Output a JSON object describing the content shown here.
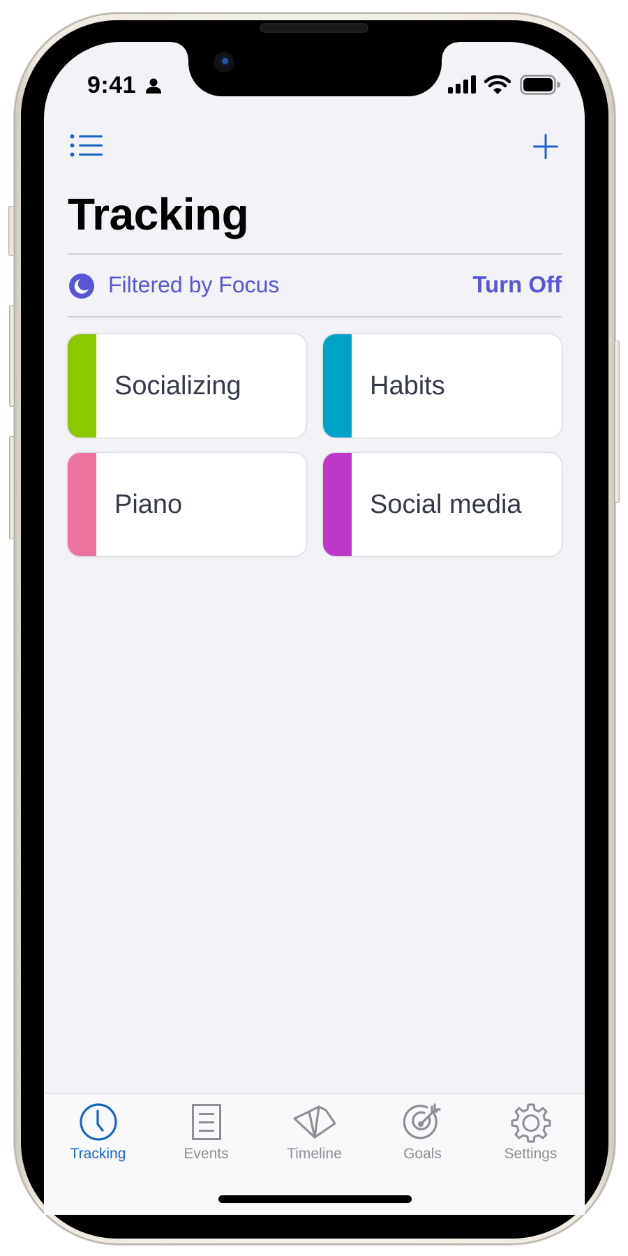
{
  "status_bar": {
    "time": "9:41",
    "icons": [
      "person-icon",
      "cellular-signal-icon",
      "wifi-icon",
      "battery-icon"
    ]
  },
  "nav": {
    "left_icon": "list-icon",
    "right_icon": "plus-icon"
  },
  "page": {
    "title": "Tracking"
  },
  "focus_filter": {
    "icon": "moon-icon",
    "label": "Filtered by Focus",
    "action_label": "Turn Off",
    "color": "#5856d6"
  },
  "categories": [
    {
      "label": "Socializing",
      "color": "#8cc800"
    },
    {
      "label": "Habits",
      "color": "#00a3c8"
    },
    {
      "label": "Piano",
      "color": "#ee739e"
    },
    {
      "label": "Social media",
      "color": "#bf36c8"
    }
  ],
  "tab_bar": {
    "active_color": "#1565c0",
    "inactive_color": "#8e8e93",
    "tabs": [
      {
        "label": "Tracking",
        "icon": "clock-icon",
        "active": true
      },
      {
        "label": "Events",
        "icon": "document-list-icon",
        "active": false
      },
      {
        "label": "Timeline",
        "icon": "timeline-fan-icon",
        "active": false
      },
      {
        "label": "Goals",
        "icon": "target-icon",
        "active": false
      },
      {
        "label": "Settings",
        "icon": "gear-icon",
        "active": false
      }
    ]
  }
}
